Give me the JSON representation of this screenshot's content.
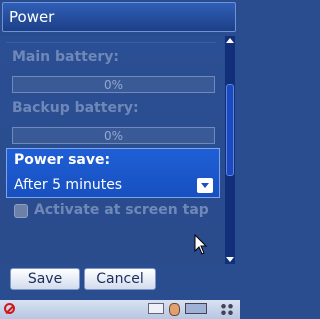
{
  "window": {
    "title": "Power"
  },
  "main_battery": {
    "label": "Main battery:",
    "percent_text": "0%",
    "level": 0
  },
  "backup_battery": {
    "label": "Backup battery:",
    "percent_text": "0%",
    "level": 0
  },
  "power_save": {
    "label": "Power save:",
    "value": "After 5 minutes"
  },
  "activate_tap": {
    "label": "Activate at screen tap",
    "checked": false
  },
  "buttons": {
    "save": "Save",
    "cancel": "Cancel"
  },
  "icons": {
    "taskbar_left": "no-entry-icon",
    "taskbar_right": [
      "keyboard-icon",
      "face-icon",
      "battery-icon",
      "grid-icon"
    ],
    "pointer": "mouse-pointer-icon"
  },
  "colors": {
    "selection": "#1f5fd6",
    "background": "#2a4d90",
    "titlebar": "#2f5fb8"
  }
}
